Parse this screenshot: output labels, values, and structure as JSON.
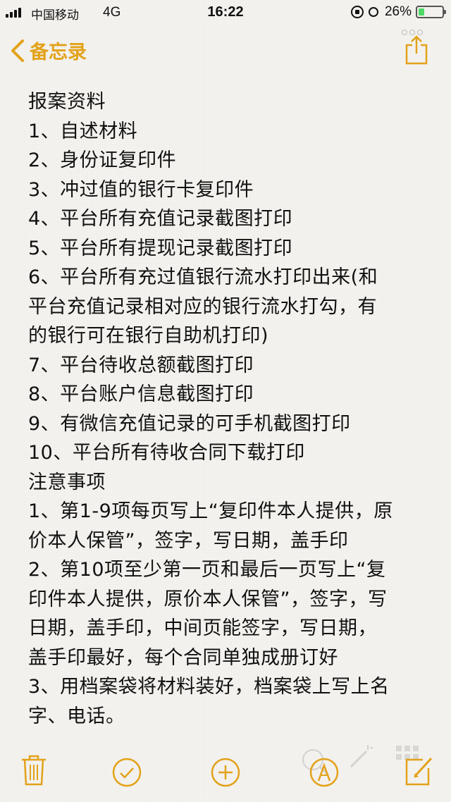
{
  "status_bar": {
    "carrier": "中国移动",
    "network": "4G",
    "time": "16:22",
    "battery_text": "26%",
    "battery_level": 0.26,
    "battery_color": "#4cd964"
  },
  "nav": {
    "back_label": "备忘录",
    "accent_color": "#e3a21a",
    "share_icon": "share-icon"
  },
  "note": {
    "lines": [
      "报案资料",
      "1、自述材料",
      "2、身份证复印件",
      "3、冲过值的银行卡复印件",
      "4、平台所有充值记录截图打印",
      "5、平台所有提现记录截图打印",
      "6、平台所有充过值银行流水打印出来(和",
      "平台充值记录相对应的银行流水打勾，有",
      "的银行可在银行自助机打印)",
      "7、平台待收总额截图打印",
      "8、平台账户信息截图打印",
      "9、有微信充值记录的可手机截图打印",
      "10、平台所有待收合同下载打印",
      "注意事项",
      "1、第1-9项每页写上“复印件本人提供，原",
      "价本人保管”，签字，写日期，盖手印",
      "2、第10项至少第一页和最后一页写上“复",
      "印件本人提供，原价本人保管”，签字，写",
      "日期，盖手印，中间页能签字，写日期，",
      "盖手印最好，每个合同单独成册订好",
      "3、用档案袋将材料装好，档案袋上写上名",
      "字、电话。"
    ]
  },
  "toolbar": {
    "icons": [
      "trash-icon",
      "checkmark-icon",
      "add-icon",
      "markup-icon",
      "compose-icon"
    ]
  }
}
